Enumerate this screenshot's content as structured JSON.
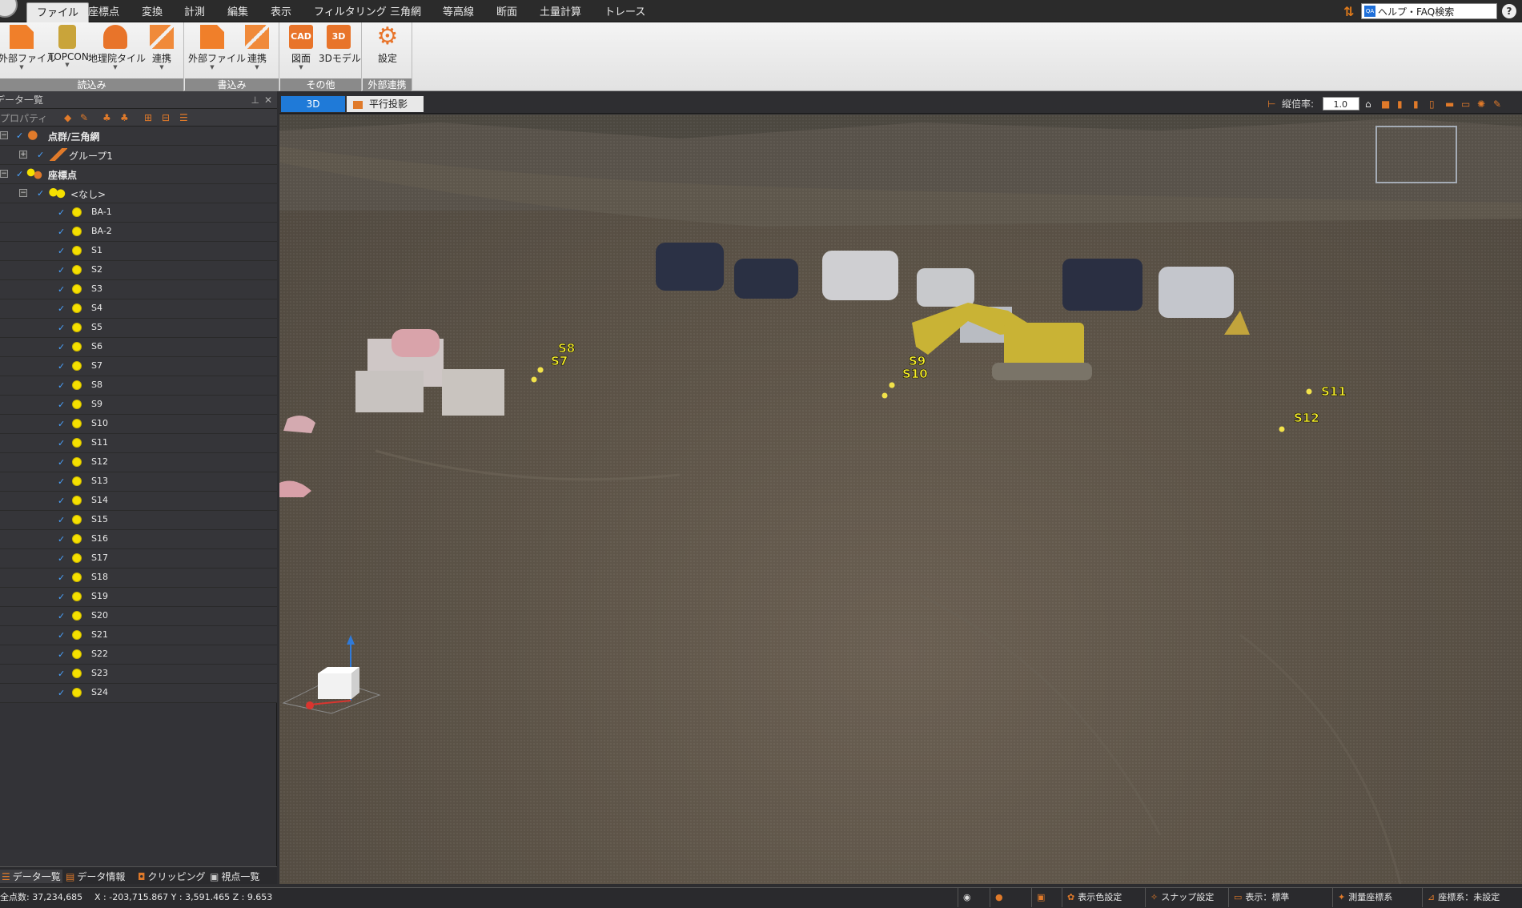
{
  "menu": {
    "tabs": [
      "ファイル",
      "座標点",
      "変換",
      "計測",
      "編集",
      "表示",
      "フィルタリング",
      "三角網",
      "等高線",
      "断面",
      "土量計算",
      "トレース"
    ],
    "help_search": "ヘルプ・FAQ検索",
    "qa_badge": "QA",
    "help_symbol": "?"
  },
  "ribbon": {
    "groups": [
      {
        "caption": "読込み",
        "buttons": [
          "外部ファイル",
          "TOPCON",
          "地理院タイル",
          "連携"
        ]
      },
      {
        "caption": "書込み",
        "buttons": [
          "外部ファイル",
          "連携"
        ]
      },
      {
        "caption": "その他",
        "buttons": [
          "図面",
          "3Dモデル"
        ]
      },
      {
        "caption": "外部連携",
        "buttons": [
          "設定"
        ]
      }
    ],
    "icon_text": {
      "cad": "CAD",
      "threed": "3D"
    }
  },
  "panel": {
    "title": "データ一覧",
    "property_label": "プロパティ",
    "tree": {
      "pointcloud": "点群/三角網",
      "group": "グループ1",
      "coords": "座標点",
      "none": "<なし>",
      "points": [
        "BA-1",
        "BA-2",
        "S1",
        "S2",
        "S3",
        "S4",
        "S5",
        "S6",
        "S7",
        "S8",
        "S9",
        "S10",
        "S11",
        "S12",
        "S13",
        "S14",
        "S15",
        "S16",
        "S17",
        "S18",
        "S19",
        "S20",
        "S21",
        "S22",
        "S23",
        "S24"
      ]
    },
    "tabs": [
      "データ一覧",
      "データ情報",
      "クリッピング",
      "視点一覧"
    ]
  },
  "viewport": {
    "tab_3d": "3D",
    "tab_parallel": "平行投影",
    "scale_label": "縦倍率:",
    "scale_value": "1.0",
    "markers": [
      {
        "label": "S8"
      },
      {
        "label": "S7"
      },
      {
        "label": "S9"
      },
      {
        "label": "S10"
      },
      {
        "label": "S11"
      },
      {
        "label": "S12"
      }
    ]
  },
  "status": {
    "points_total": "全点数: 37,234,685",
    "coords": "X : -203,715.867  Y : 3,591.465  Z : 9.653",
    "display_color": "表示色設定",
    "snap": "スナップ設定",
    "display_mode": "表示：標準",
    "survey_system": "測量座標系",
    "coord_system": "座標系：未設定"
  },
  "colors": {
    "accent": "#1f7ad8",
    "orange": "#e07a2a",
    "marker": "#f7ef2a"
  }
}
